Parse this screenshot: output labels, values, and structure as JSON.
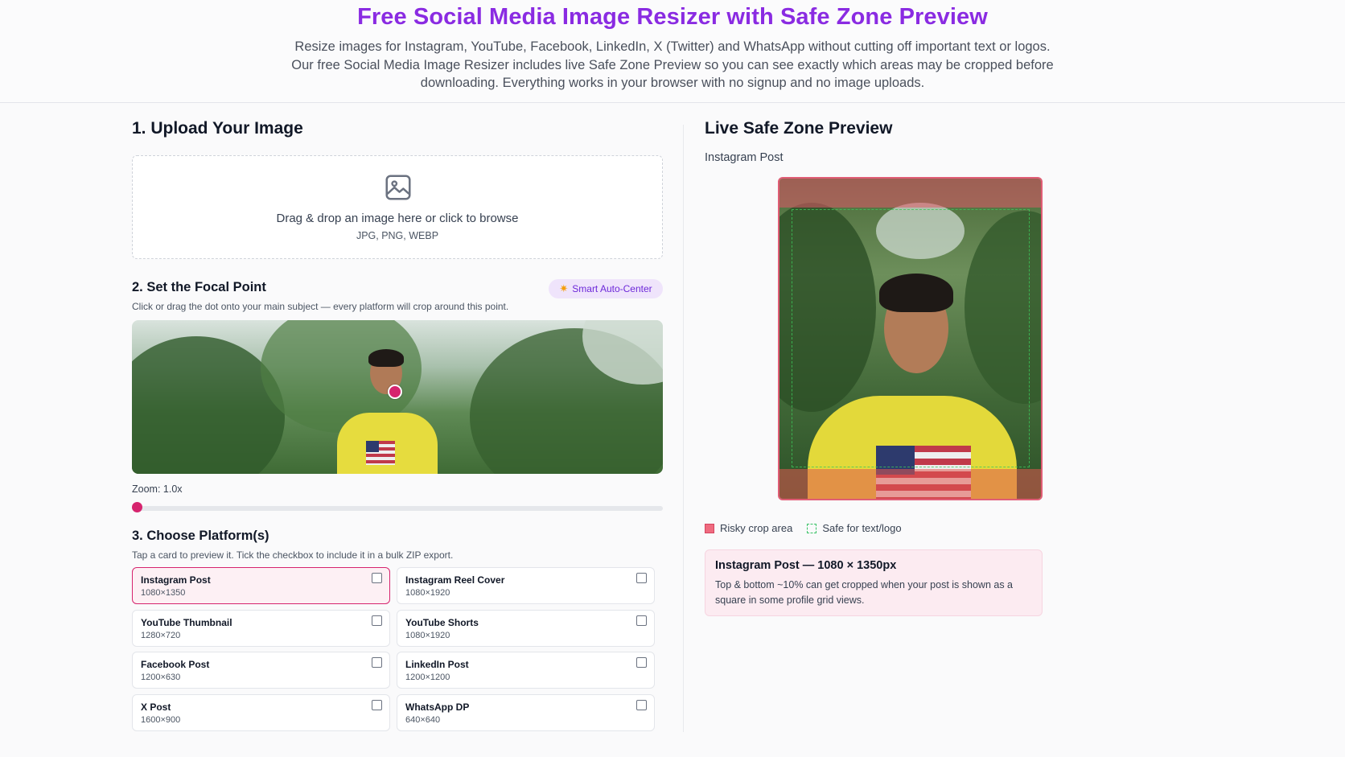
{
  "header": {
    "title": "Free Social Media Image Resizer with Safe Zone Preview",
    "intro": "Resize images for Instagram, YouTube, Facebook, LinkedIn, X (Twitter) and WhatsApp without cutting off important text or logos. Our free Social Media Image Resizer includes live Safe Zone Preview so you can see exactly which areas may be cropped before downloading. Everything works in your browser with no signup and no image uploads."
  },
  "upload": {
    "heading": "1. Upload Your Image",
    "drop_text": "Drag & drop an image here or click to browse",
    "formats": "JPG, PNG, WEBP",
    "icon": "image-icon"
  },
  "focal": {
    "heading": "2. Set the Focal Point",
    "hint": "Click or drag the dot onto your main subject — every platform will crop around this point.",
    "smart_button": "Smart Auto-Center",
    "smart_icon": "sparkle-icon",
    "zoom_label": "Zoom: 1.0x",
    "zoom_value": 1.0
  },
  "platforms": {
    "heading": "3. Choose Platform(s)",
    "hint": "Tap a card to preview it. Tick the checkbox to include it in a bulk ZIP export.",
    "items": [
      {
        "name": "Instagram Post",
        "size": "1080×1350",
        "active": true
      },
      {
        "name": "Instagram Reel Cover",
        "size": "1080×1920",
        "active": false
      },
      {
        "name": "YouTube Thumbnail",
        "size": "1280×720",
        "active": false
      },
      {
        "name": "YouTube Shorts",
        "size": "1080×1920",
        "active": false
      },
      {
        "name": "Facebook Post",
        "size": "1200×630",
        "active": false
      },
      {
        "name": "LinkedIn Post",
        "size": "1200×1200",
        "active": false
      },
      {
        "name": "X Post",
        "size": "1600×900",
        "active": false
      },
      {
        "name": "WhatsApp DP",
        "size": "640×640",
        "active": false
      }
    ]
  },
  "preview": {
    "heading": "Live Safe Zone Preview",
    "platform": "Instagram Post",
    "legend_risky": "Risky crop area",
    "legend_safe": "Safe for text/logo",
    "info_title": "Instagram Post — 1080 × 1350px",
    "info_text": "Top & bottom ~10% can get cropped when your post is shown as a square in some profile grid views."
  },
  "colors": {
    "title": "#8a2be2",
    "accent": "#d6246e",
    "risky": "#ef6b7f",
    "safe": "#3ac267"
  }
}
